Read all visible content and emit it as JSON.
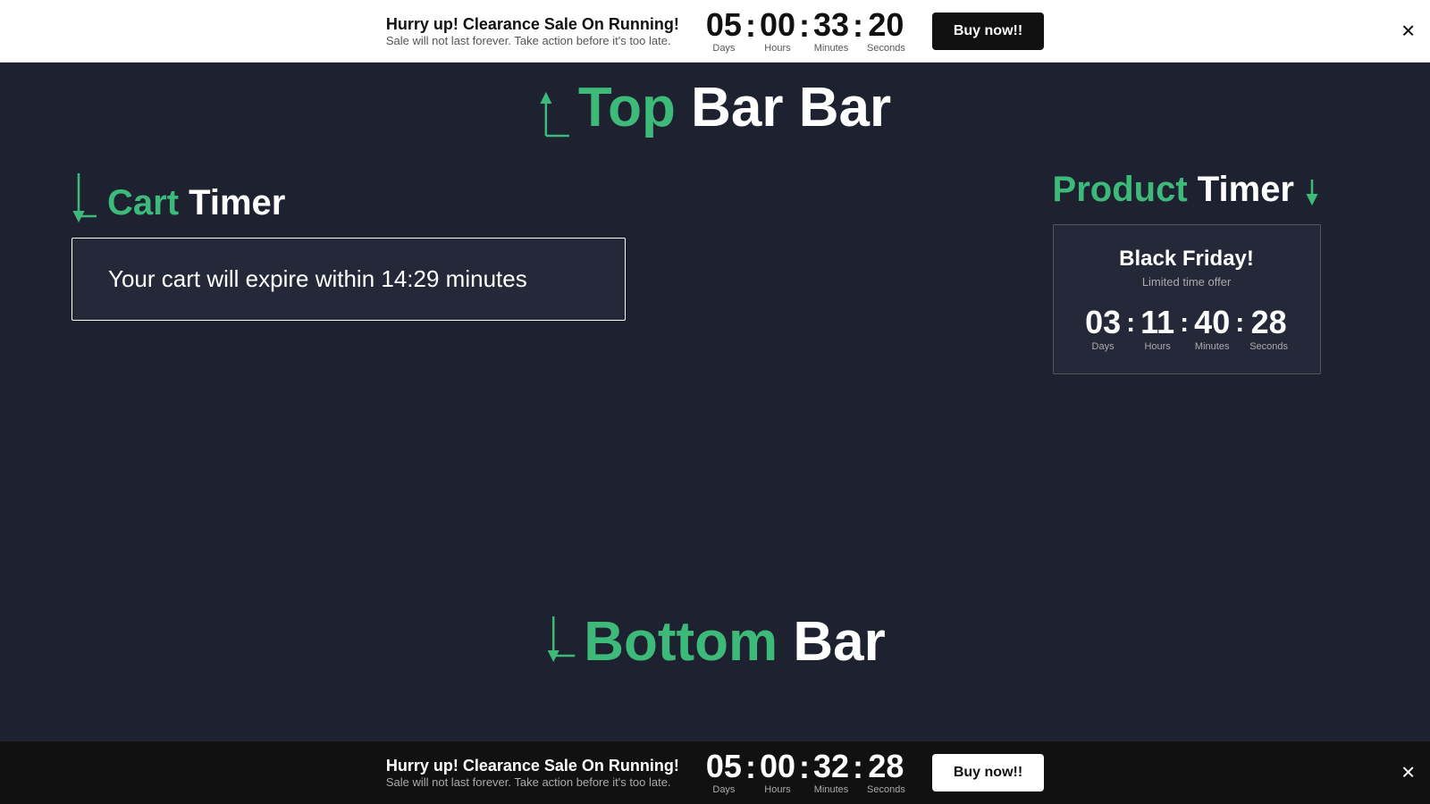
{
  "top_bar": {
    "headline": "Hurry up! Clearance Sale On Running!",
    "subline": "Sale will not last forever. Take action before it's too late.",
    "days": "05",
    "hours": "00",
    "minutes": "33",
    "seconds": "20",
    "days_label": "Days",
    "hours_label": "Hours",
    "minutes_label": "Minutes",
    "seconds_label": "Seconds",
    "buy_btn": "Buy now!!",
    "close": "✕"
  },
  "top_bar_label": {
    "heading_green": "Top",
    "heading_white": "Bar"
  },
  "cart_timer": {
    "heading_green": "Cart",
    "heading_white": "Timer",
    "box_text": "Your cart  will expire within 14:29 minutes"
  },
  "product_timer": {
    "heading_green": "Product",
    "heading_white": "Timer",
    "title": "Black Friday!",
    "subtitle": "Limited time offer",
    "days": "03",
    "hours": "11",
    "minutes": "40",
    "seconds": "28",
    "days_label": "Days",
    "hours_label": "Hours",
    "minutes_label": "Minutes",
    "seconds_label": "Seconds"
  },
  "bottom_bar_label": {
    "heading_green": "Bottom",
    "heading_white": "Bar"
  },
  "bottom_bar": {
    "headline": "Hurry up! Clearance Sale On Running!",
    "subline": "Sale will not last forever. Take action before it's too late.",
    "days": "05",
    "hours": "00",
    "minutes": "32",
    "seconds": "28",
    "days_label": "Days",
    "hours_label": "Hours",
    "minutes_label": "Minutes",
    "seconds_label": "Seconds",
    "buy_btn": "Buy now!!",
    "close": "✕"
  }
}
